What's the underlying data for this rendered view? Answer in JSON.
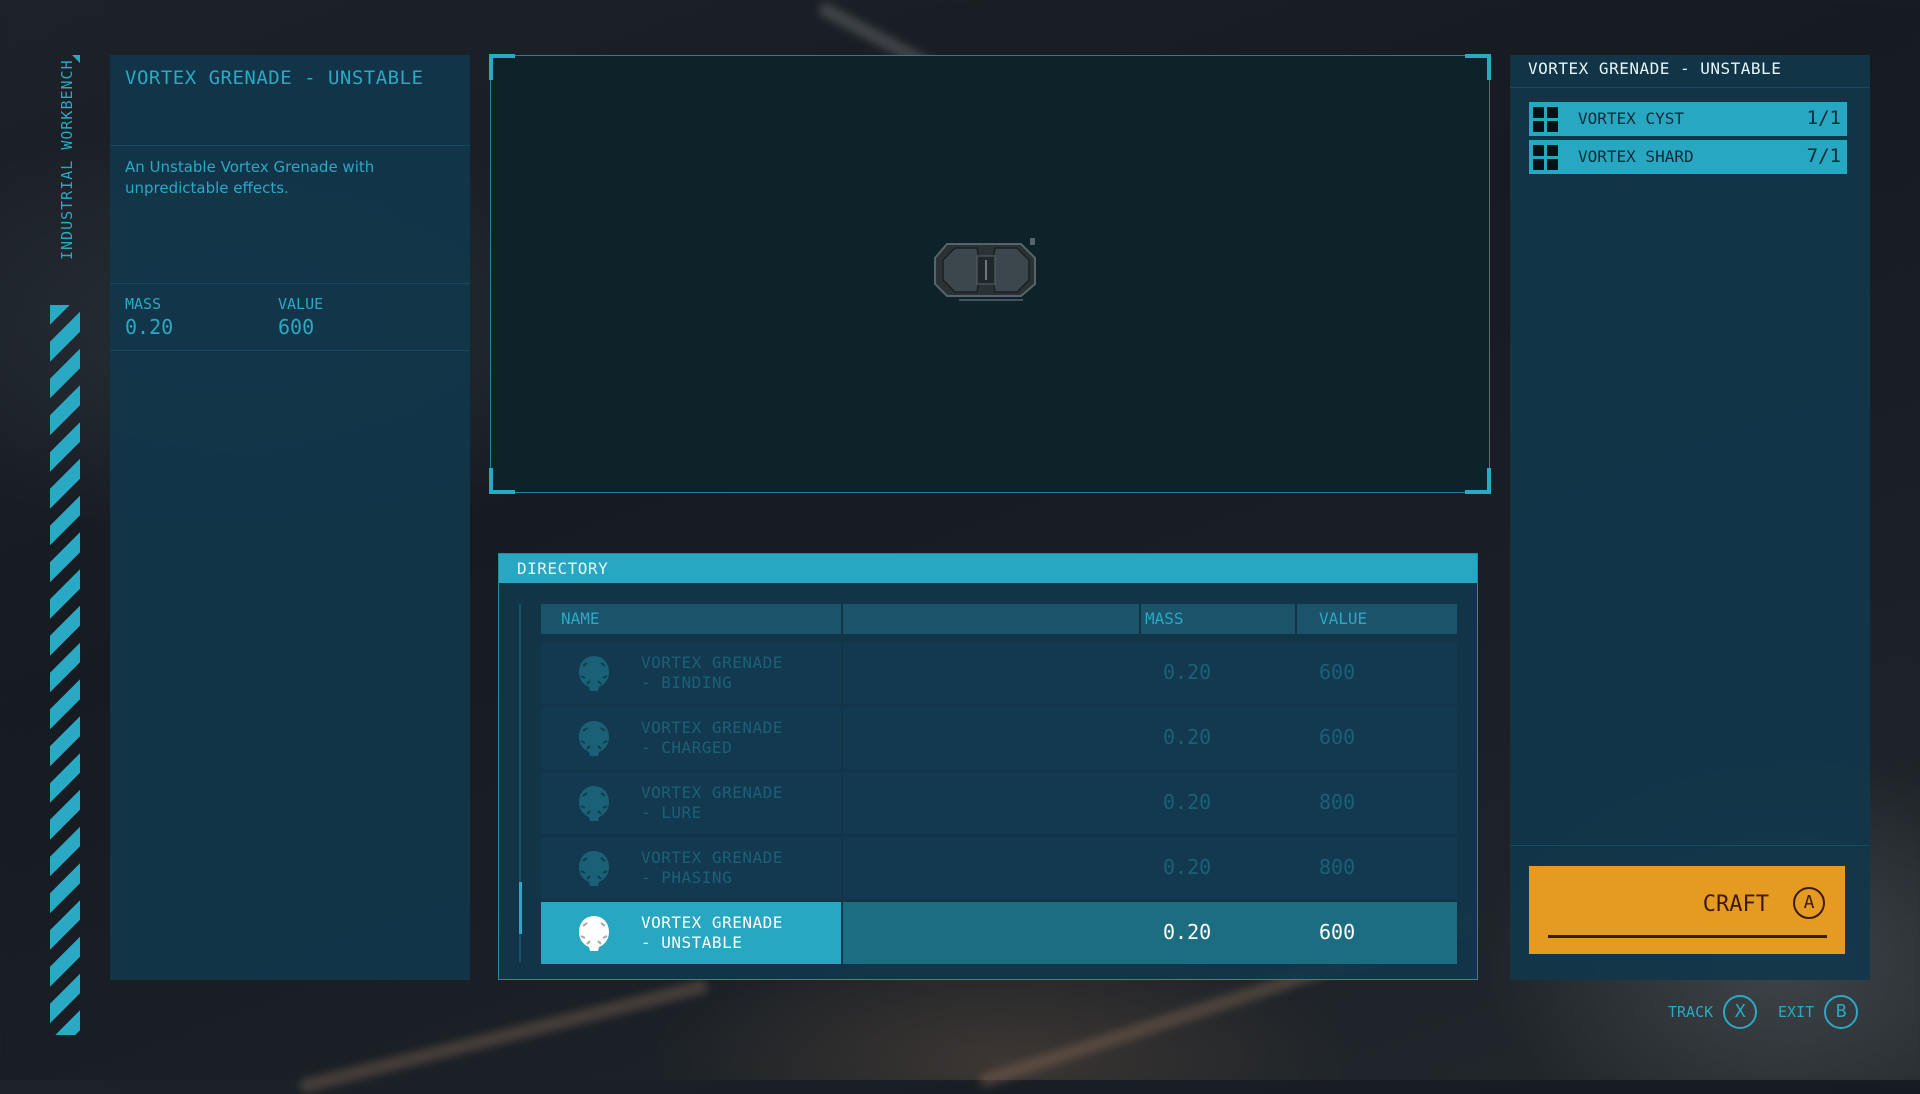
{
  "workbench": {
    "title": "INDUSTRIAL WORKBENCH"
  },
  "item": {
    "title": "VORTEX GRENADE - UNSTABLE",
    "description": "An Unstable Vortex Grenade with unpredictable effects.",
    "mass_label": "MASS",
    "mass": "0.20",
    "value_label": "VALUE",
    "value": "600"
  },
  "preview": {
    "model_icon": "vortex-grenade-model"
  },
  "directory": {
    "title": "DIRECTORY",
    "columns": {
      "name": "NAME",
      "mass": "MASS",
      "value": "VALUE"
    },
    "rows": [
      {
        "line1": "VORTEX GRENADE",
        "line2": "- BINDING",
        "mass": "0.20",
        "value": "600",
        "selected": false,
        "icon": "grenade-icon"
      },
      {
        "line1": "VORTEX GRENADE",
        "line2": "- CHARGED",
        "mass": "0.20",
        "value": "600",
        "selected": false,
        "icon": "grenade-icon"
      },
      {
        "line1": "VORTEX GRENADE",
        "line2": "- LURE",
        "mass": "0.20",
        "value": "800",
        "selected": false,
        "icon": "grenade-icon"
      },
      {
        "line1": "VORTEX GRENADE",
        "line2": "- PHASING",
        "mass": "0.20",
        "value": "800",
        "selected": false,
        "icon": "grenade-icon"
      },
      {
        "line1": "VORTEX GRENADE",
        "line2": "- UNSTABLE",
        "mass": "0.20",
        "value": "600",
        "selected": true,
        "icon": "grenade-icon"
      }
    ]
  },
  "recipe": {
    "title": "VORTEX GRENADE - UNSTABLE",
    "ingredients": [
      {
        "name": "VORTEX CYST",
        "count": "1/1",
        "icon": "resource-grid-icon"
      },
      {
        "name": "VORTEX SHARD",
        "count": "7/1",
        "icon": "resource-grid-icon"
      }
    ],
    "craft_label": "CRAFT",
    "craft_key": "A"
  },
  "footer": {
    "track_label": "TRACK",
    "track_key": "X",
    "exit_label": "EXIT",
    "exit_key": "B"
  },
  "colors": {
    "accent": "#27a7c2",
    "panel": "#11364b",
    "craft": "#e59a22",
    "craft_text": "#3a1a0c"
  }
}
